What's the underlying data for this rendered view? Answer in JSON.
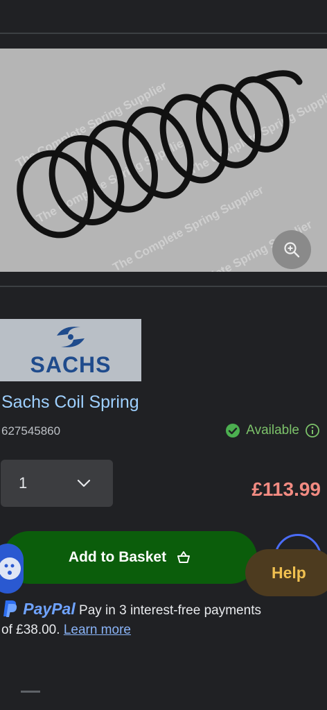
{
  "hero": {
    "watermark": "The Complete Spring Supplier"
  },
  "brand": {
    "logo_text": "SACHS"
  },
  "product": {
    "title": "Sachs Coil Spring",
    "sku": "627545860",
    "availability": "Available",
    "price": "£113.99"
  },
  "quantity": {
    "selected": "1"
  },
  "actions": {
    "add_to_basket": "Add to Basket",
    "help": "Help"
  },
  "paypal": {
    "brand": "PayPal",
    "text_line1": "Pay in 3 interest-free payments",
    "text_line2": "of £38.00.",
    "learn_more": "Learn more"
  },
  "colors": {
    "price": "#f28b82",
    "title": "#9ed0ff",
    "available": "#7cc26a",
    "basket_bg": "#0b5d0b",
    "help_bg": "#4d3b1f",
    "help_text": "#f0c050"
  },
  "icons": {
    "zoom": "zoom-in-icon",
    "available": "check-circle-icon",
    "info": "info-icon",
    "dropdown": "chevron-down-icon",
    "basket": "basket-icon"
  }
}
